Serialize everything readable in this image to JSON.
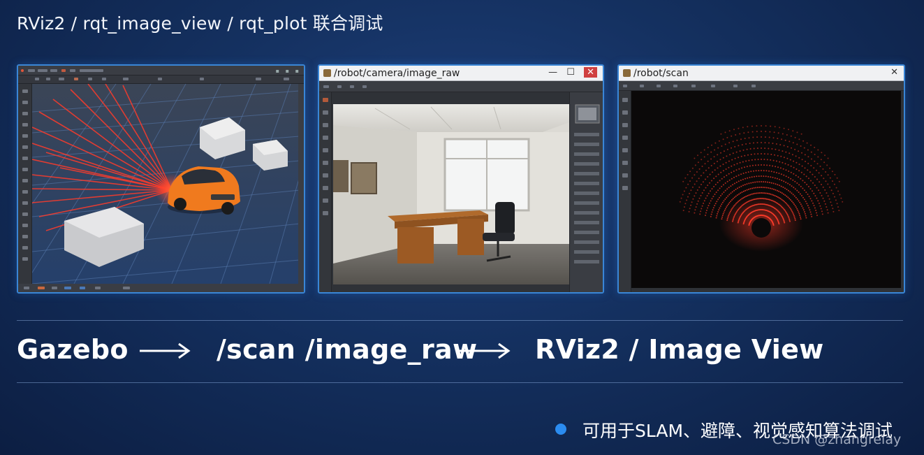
{
  "slide": {
    "title": "RViz2 / rqt_image_view / rqt_plot 联合调试"
  },
  "panels": {
    "rviz": {
      "name": "RViz2 3D view",
      "menubar_hint": "File  Edit  ...  Help"
    },
    "image_view": {
      "window_title": "/robot/camera/image_raw",
      "controls": [
        "—",
        "☐",
        "✕"
      ]
    },
    "scan_view": {
      "window_title": "/robot/scan",
      "controls": [
        "✕"
      ]
    }
  },
  "pipeline": {
    "source": "Gazebo",
    "topics": "/scan /image_raw",
    "sink": "RViz2 / Image View"
  },
  "bullet": {
    "text": "可用于SLAM、避障、视觉感知算法调试"
  },
  "watermark": "CSDN @zhangrelay",
  "colors": {
    "accent_blue": "#2b8cf0",
    "panel_border": "#3a86d6",
    "laser_red": "#ff3b2a",
    "car_orange": "#f07a1e"
  }
}
